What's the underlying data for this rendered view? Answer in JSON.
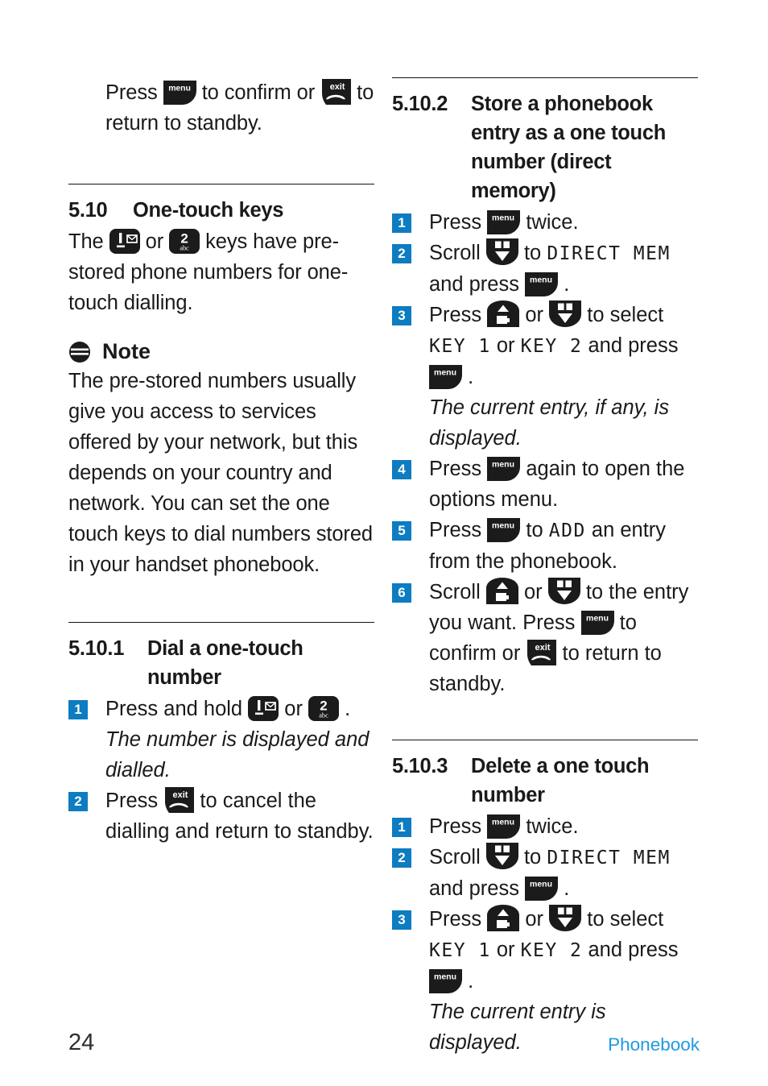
{
  "page": {
    "number": "24",
    "section_label": "Phonebook",
    "accent_blue": "#0d7cc0",
    "footer_blue": "#1f9ae0"
  },
  "icons": {
    "menu": "menu-softkey-icon",
    "exit": "exit-softkey-icon",
    "key1": "keypad-1-message-icon",
    "key2": "keypad-2-abc-icon",
    "scroll_up": "scroll-up-redial-icon",
    "scroll_down": "scroll-down-phonebook-icon",
    "note": "note-icon",
    "menu_label": "menu",
    "exit_label": "exit",
    "key1_label": "1",
    "key2_label": "2",
    "key2_sub": "abc"
  },
  "left_column": {
    "intro": {
      "t1": "Press",
      "t2": "to confirm or",
      "t3": "to return to standby."
    },
    "section_5_10": {
      "number": "5.10",
      "title": "One-touch keys",
      "body_1": "The",
      "body_2": "or",
      "body_3": "keys have pre-stored phone numbers for one-touch dialling."
    },
    "note": {
      "heading": "Note",
      "body": "The pre-stored numbers usually give you access to services offered by your network, but this depends on your country and network. You can set the one touch keys to dial numbers stored in your handset phonebook."
    },
    "section_5_10_1": {
      "number": "5.10.1",
      "title": "Dial a one-touch number",
      "steps": [
        {
          "n": "1",
          "parts": [
            "Press and hold",
            "or",
            "."
          ],
          "sub": "The number is displayed and dialled."
        },
        {
          "n": "2",
          "parts": [
            "Press",
            "to cancel the dialling and return to standby."
          ],
          "sub": ""
        }
      ]
    }
  },
  "right_column": {
    "section_5_10_2": {
      "number": "5.10.2",
      "title": "Store a phonebook entry as a one touch number (direct memory)",
      "steps": [
        {
          "n": "1",
          "a": "Press",
          "b": "twice."
        },
        {
          "n": "2",
          "a": "Scroll",
          "b": "to",
          "lcd": "DIRECT MEM",
          "c": "and press",
          "d": "."
        },
        {
          "n": "3",
          "a": "Press",
          "b": "or",
          "c": "to select",
          "lcd1": "KEY 1",
          "mid": "or",
          "lcd2": "KEY 2",
          "d": "and press",
          "e": ".",
          "sub": "The current entry, if any, is displayed."
        },
        {
          "n": "4",
          "a": "Press",
          "b": "again to open the options menu."
        },
        {
          "n": "5",
          "a": "Press",
          "b": "to",
          "lcd": "ADD",
          "c": "an entry from the phonebook."
        },
        {
          "n": "6",
          "a": "Scroll",
          "b": "or",
          "c": "to the entry you want. Press",
          "d": "to confirm or",
          "e": "to return to standby."
        }
      ]
    },
    "section_5_10_3": {
      "number": "5.10.3",
      "title": "Delete a one touch number",
      "steps": [
        {
          "n": "1",
          "a": "Press",
          "b": "twice."
        },
        {
          "n": "2",
          "a": "Scroll",
          "b": "to",
          "lcd": "DIRECT MEM",
          "c": "and press",
          "d": "."
        },
        {
          "n": "3",
          "a": "Press",
          "b": "or",
          "c": "to select",
          "lcd1": "KEY 1",
          "mid": "or",
          "lcd2": "KEY 2",
          "d": "and press",
          "e": ".",
          "sub": "The current entry is displayed."
        }
      ]
    }
  }
}
